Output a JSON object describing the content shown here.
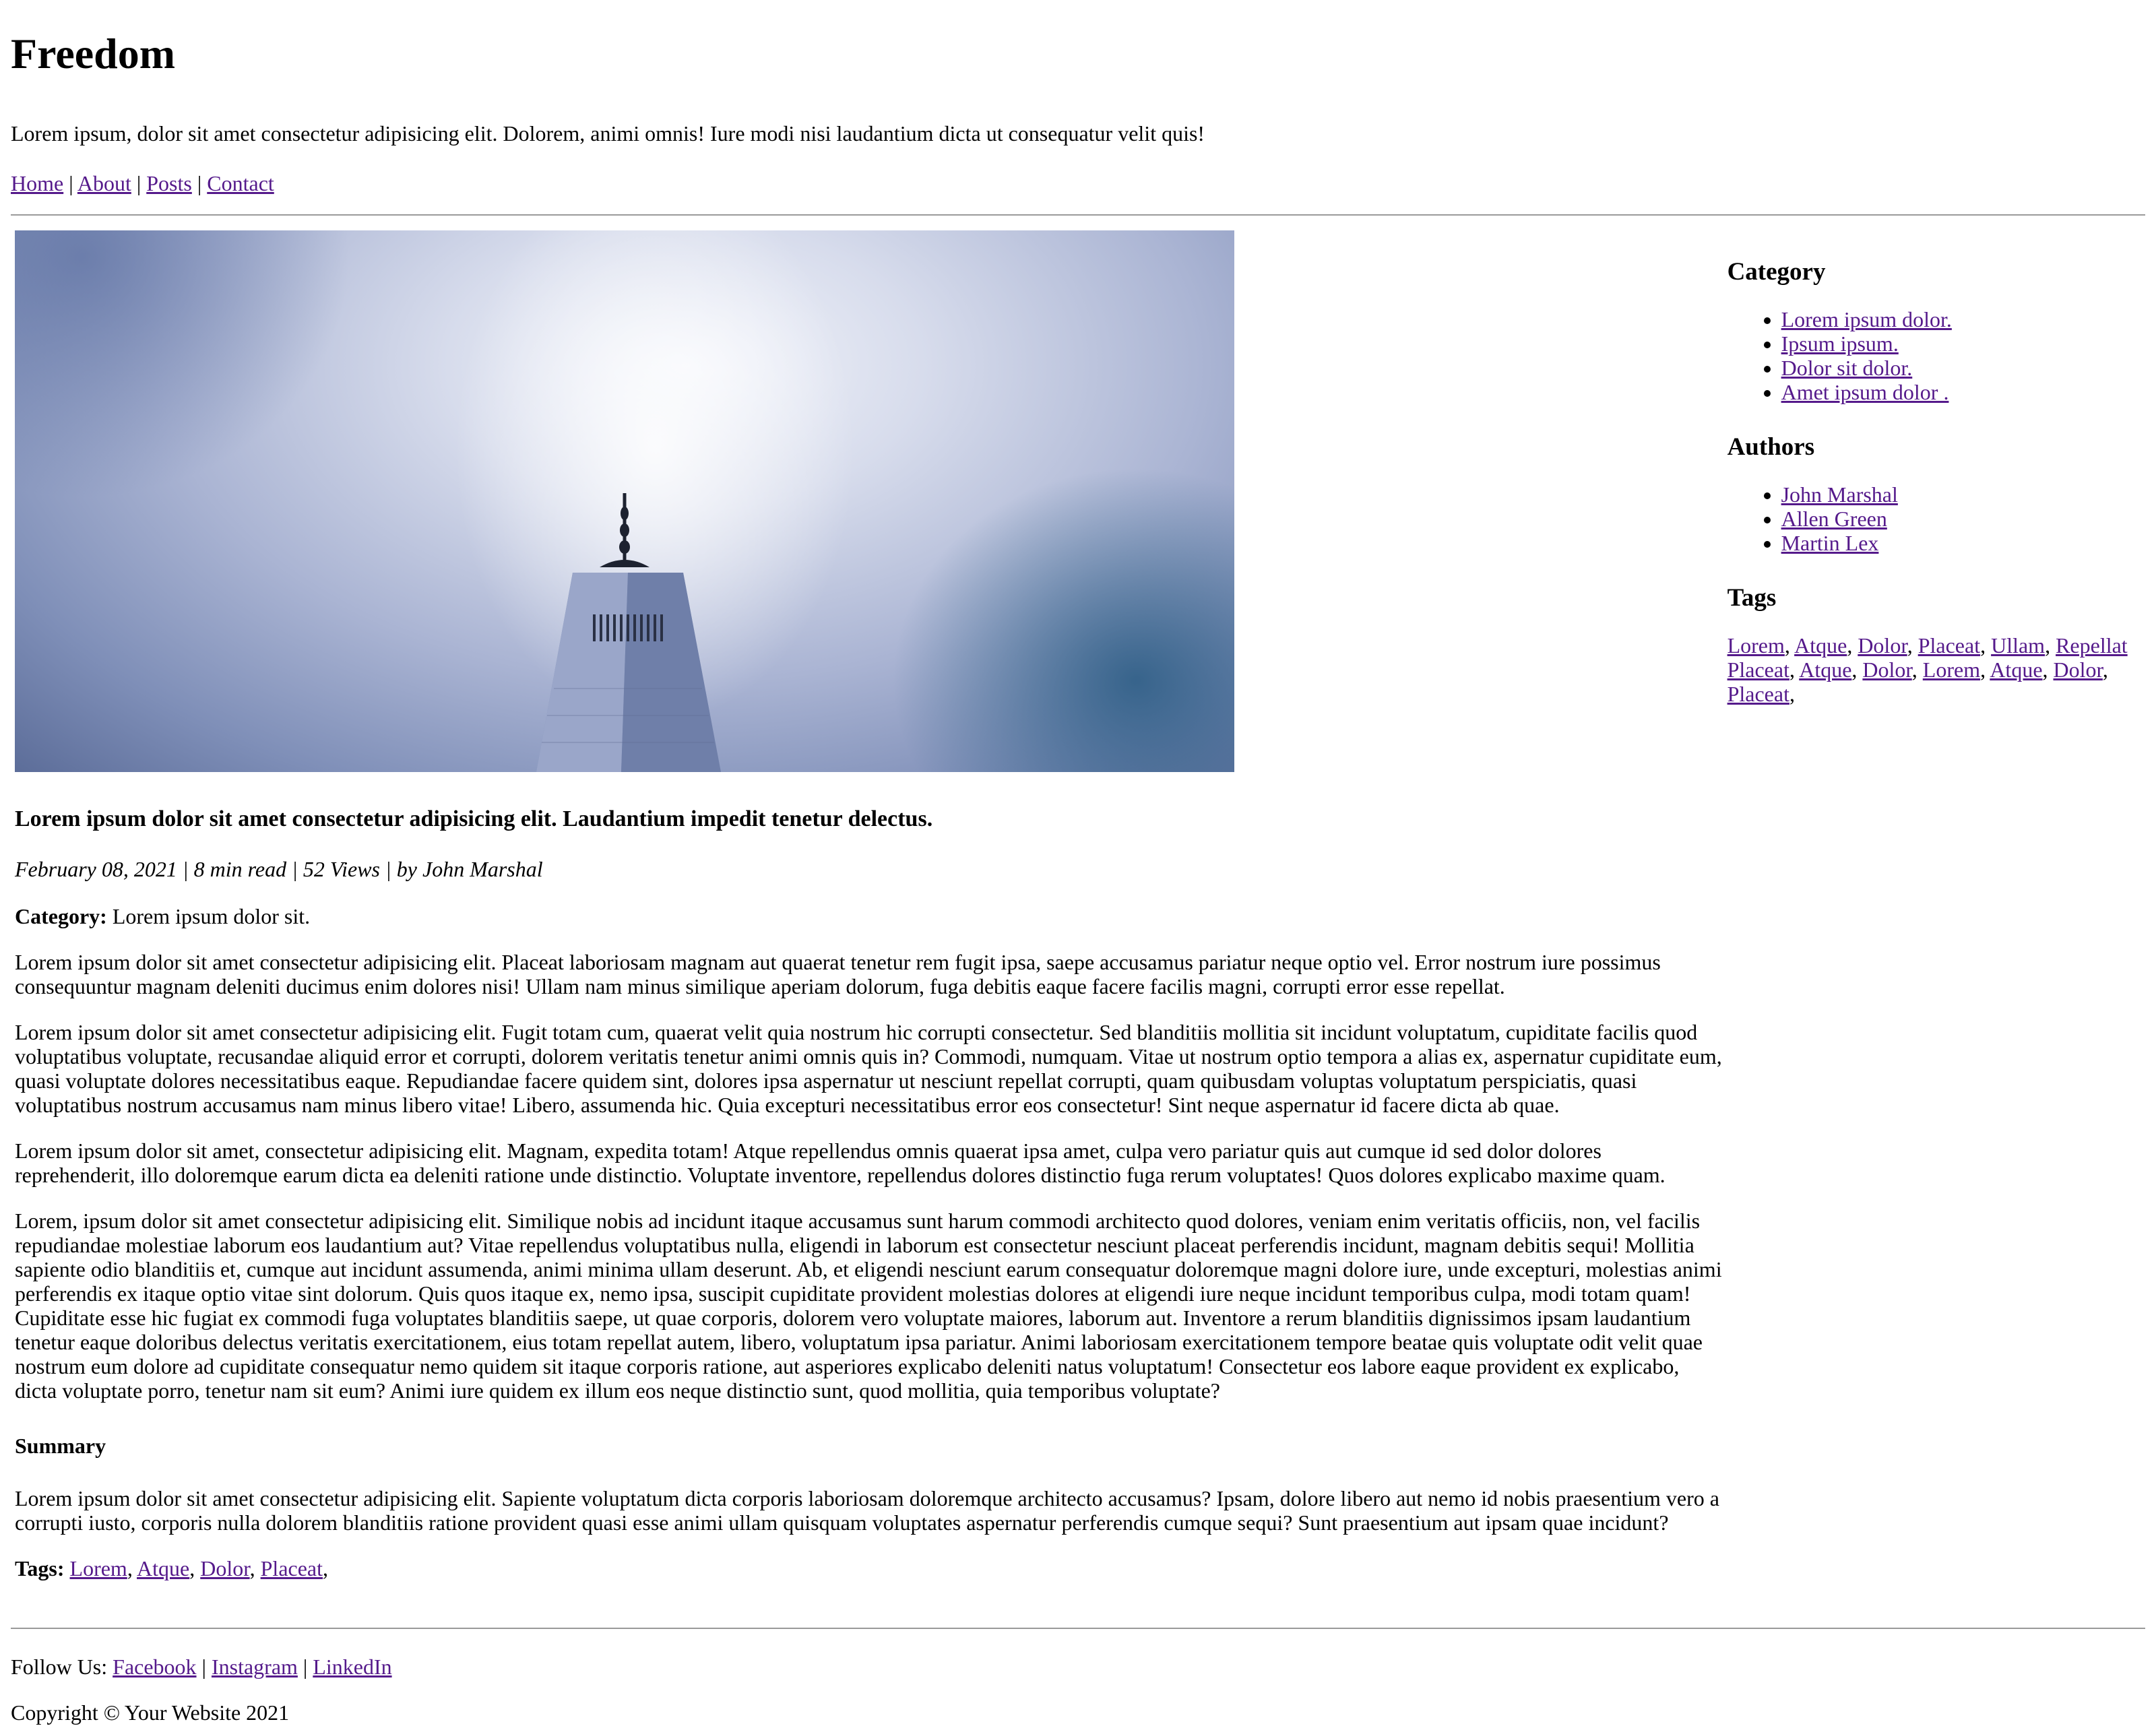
{
  "header": {
    "site_title": "Freedom",
    "tagline": "Lorem ipsum, dolor sit amet consectetur adipisicing elit. Dolorem, animi omnis! Iure modi nisi laudantium dicta ut consequatur velit quis!",
    "nav": [
      "Home",
      "About",
      "Posts",
      "Contact"
    ],
    "nav_separator": "|"
  },
  "post": {
    "title": "Lorem ipsum dolor sit amet consectetur adipisicing elit. Laudantium impedit tenetur delectus.",
    "meta": "February 08, 2021 | 8 min read | 52 Views | by John Marshal",
    "category_label": "Category:",
    "category_value": "Lorem ipsum dolor sit.",
    "paragraphs": [
      "Lorem ipsum dolor sit amet consectetur adipisicing elit. Placeat laboriosam magnam aut quaerat tenetur rem fugit ipsa, saepe accusamus pariatur neque optio vel. Error nostrum iure possimus consequuntur magnam deleniti ducimus enim dolores nisi! Ullam nam minus similique aperiam dolorum, fuga debitis eaque facere facilis magni, corrupti error esse repellat.",
      "Lorem ipsum dolor sit amet consectetur adipisicing elit. Fugit totam cum, quaerat velit quia nostrum hic corrupti consectetur. Sed blanditiis mollitia sit incidunt voluptatum, cupiditate facilis quod voluptatibus voluptate, recusandae aliquid error et corrupti, dolorem veritatis tenetur animi omnis quis in? Commodi, numquam. Vitae ut nostrum optio tempora a alias ex, aspernatur cupiditate eum, quasi voluptate dolores necessitatibus eaque. Repudiandae facere quidem sint, dolores ipsa aspernatur ut nesciunt repellat corrupti, quam quibusdam voluptas voluptatum perspiciatis, quasi voluptatibus nostrum accusamus nam minus libero vitae! Libero, assumenda hic. Quia excepturi necessitatibus error eos consectetur! Sint neque aspernatur id facere dicta ab quae.",
      "Lorem ipsum dolor sit amet, consectetur adipisicing elit. Magnam, expedita totam! Atque repellendus omnis quaerat ipsa amet, culpa vero pariatur quis aut cumque id sed dolor dolores reprehenderit, illo doloremque earum dicta ea deleniti ratione unde distinctio. Voluptate inventore, repellendus dolores distinctio fuga rerum voluptates! Quos dolores explicabo maxime quam.",
      "Lorem, ipsum dolor sit amet consectetur adipisicing elit. Similique nobis ad incidunt itaque accusamus sunt harum commodi architecto quod dolores, veniam enim veritatis officiis, non, vel facilis repudiandae molestiae laborum eos laudantium aut? Vitae repellendus voluptatibus nulla, eligendi in laborum est consectetur nesciunt placeat perferendis incidunt, magnam debitis sequi! Mollitia sapiente odio blanditiis et, cumque aut incidunt assumenda, animi minima ullam deserunt. Ab, et eligendi nesciunt earum consequatur doloremque magni dolore iure, unde excepturi, molestias animi perferendis ex itaque optio vitae sint dolorum. Quis quos itaque ex, nemo ipsa, suscipit cupiditate provident molestias dolores at eligendi iure neque incidunt temporibus culpa, modi totam quam! Cupiditate esse hic fugiat ex commodi fuga voluptates blanditiis saepe, ut quae corporis, dolorem vero voluptate maiores, laborum aut. Inventore a rerum blanditiis dignissimos ipsam laudantium tenetur eaque doloribus delectus veritatis exercitationem, eius totam repellat autem, libero, voluptatum ipsa pariatur. Animi laboriosam exercitationem tempore beatae quis voluptate odit velit quae nostrum eum dolore ad cupiditate consequatur nemo quidem sit itaque corporis ratione, aut asperiores explicabo deleniti natus voluptatum! Consectetur eos labore eaque provident ex explicabo, dicta voluptate porro, tenetur nam sit eum? Animi iure quidem ex illum eos neque distinctio sunt, quod mollitia, quia temporibus voluptate?"
    ],
    "summary_heading": "Summary",
    "summary": "Lorem ipsum dolor sit amet consectetur adipisicing elit. Sapiente voluptatum dicta corporis laboriosam doloremque architecto accusamus? Ipsam, dolore libero aut nemo id nobis praesentium vero a corrupti iusto, corporis nulla dolorem blanditiis ratione provident quasi esse animi ullam quisquam voluptates aspernatur perferendis cumque sequi? Sunt praesentium aut ipsam quae incidunt?",
    "tags_label": "Tags:",
    "tags": [
      "Lorem",
      "Atque",
      "Dolor",
      "Placeat"
    ]
  },
  "sidebar": {
    "category_heading": "Category",
    "categories": [
      "Lorem ipsum dolor.",
      "Ipsum ipsum.",
      "Dolor sit dolor.",
      "Amet ipsum dolor ."
    ],
    "authors_heading": "Authors",
    "authors": [
      "John Marshal",
      "Allen Green",
      "Martin Lex"
    ],
    "tags_heading": "Tags",
    "tags": [
      "Lorem",
      "Atque",
      "Dolor",
      "Placeat",
      "Ullam",
      "Repellat",
      "Placeat",
      "Atque",
      "Dolor",
      "Lorem",
      "Atque",
      "Dolor",
      "Placeat"
    ]
  },
  "footer": {
    "follow_label": "Follow Us:",
    "social": [
      "Facebook",
      "Instagram",
      "LinkedIn"
    ],
    "separator": "|",
    "copyright": "Copyright © Your Website 2021"
  },
  "colors": {
    "link": "#551a8b",
    "rule": "#9a9a9a",
    "text": "#000000",
    "background": "#ffffff"
  }
}
